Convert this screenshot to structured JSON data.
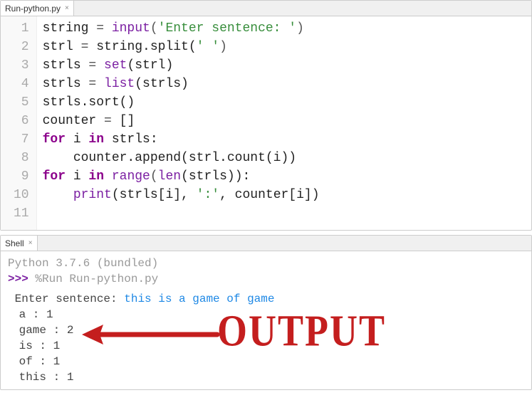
{
  "editor": {
    "tab": {
      "title": "Run-python.py"
    },
    "lines": [
      {
        "n": "1",
        "tokens": [
          {
            "t": "string",
            "c": "nm"
          },
          {
            "t": " = ",
            "c": "punct"
          },
          {
            "t": "input",
            "c": "builtin"
          },
          {
            "t": "(",
            "c": "punct"
          },
          {
            "t": "'Enter sentence: '",
            "c": "str"
          },
          {
            "t": ")",
            "c": "punct"
          }
        ]
      },
      {
        "n": "2",
        "tokens": [
          {
            "t": "strl",
            "c": "nm"
          },
          {
            "t": " = ",
            "c": "punct"
          },
          {
            "t": "string.split(",
            "c": "nm"
          },
          {
            "t": "' '",
            "c": "str"
          },
          {
            "t": ")",
            "c": "punct"
          }
        ]
      },
      {
        "n": "3",
        "tokens": [
          {
            "t": "strls",
            "c": "nm"
          },
          {
            "t": " = ",
            "c": "punct"
          },
          {
            "t": "set",
            "c": "builtin"
          },
          {
            "t": "(strl)",
            "c": "nm"
          }
        ]
      },
      {
        "n": "4",
        "tokens": [
          {
            "t": "strls",
            "c": "nm"
          },
          {
            "t": " = ",
            "c": "punct"
          },
          {
            "t": "list",
            "c": "builtin"
          },
          {
            "t": "(strls)",
            "c": "nm"
          }
        ]
      },
      {
        "n": "5",
        "tokens": [
          {
            "t": "strls.sort()",
            "c": "nm"
          }
        ]
      },
      {
        "n": "6",
        "tokens": [
          {
            "t": "counter",
            "c": "nm"
          },
          {
            "t": " = ",
            "c": "punct"
          },
          {
            "t": "[]",
            "c": "nm"
          }
        ]
      },
      {
        "n": "7",
        "tokens": [
          {
            "t": "for",
            "c": "kw"
          },
          {
            "t": " i ",
            "c": "nm"
          },
          {
            "t": "in",
            "c": "kw"
          },
          {
            "t": " strls:",
            "c": "nm"
          }
        ]
      },
      {
        "n": "8",
        "tokens": [
          {
            "t": "    counter.append(strl.count(i))",
            "c": "nm"
          }
        ]
      },
      {
        "n": "9",
        "tokens": [
          {
            "t": "for",
            "c": "kw"
          },
          {
            "t": " i ",
            "c": "nm"
          },
          {
            "t": "in",
            "c": "kw"
          },
          {
            "t": " ",
            "c": "nm"
          },
          {
            "t": "range",
            "c": "builtin"
          },
          {
            "t": "(",
            "c": "punct"
          },
          {
            "t": "len",
            "c": "builtin"
          },
          {
            "t": "(strls)):",
            "c": "nm"
          }
        ]
      },
      {
        "n": "10",
        "tokens": [
          {
            "t": "    ",
            "c": "nm"
          },
          {
            "t": "print",
            "c": "builtin"
          },
          {
            "t": "(strls[i], ",
            "c": "nm"
          },
          {
            "t": "':'",
            "c": "str"
          },
          {
            "t": ", counter[i])",
            "c": "nm"
          }
        ]
      },
      {
        "n": "11",
        "tokens": []
      }
    ]
  },
  "shell": {
    "tab": {
      "title": "Shell"
    },
    "header": "Python 3.7.6 (bundled)",
    "prompt": ">>>",
    "command": " %Run Run-python.py",
    "input_prompt": " Enter sentence: ",
    "input_value": "this is a game of game",
    "output": [
      " a : 1",
      " game : 2",
      " is : 1",
      " of : 1",
      " this : 1"
    ]
  },
  "annotation": {
    "text": "OUTPUT"
  }
}
